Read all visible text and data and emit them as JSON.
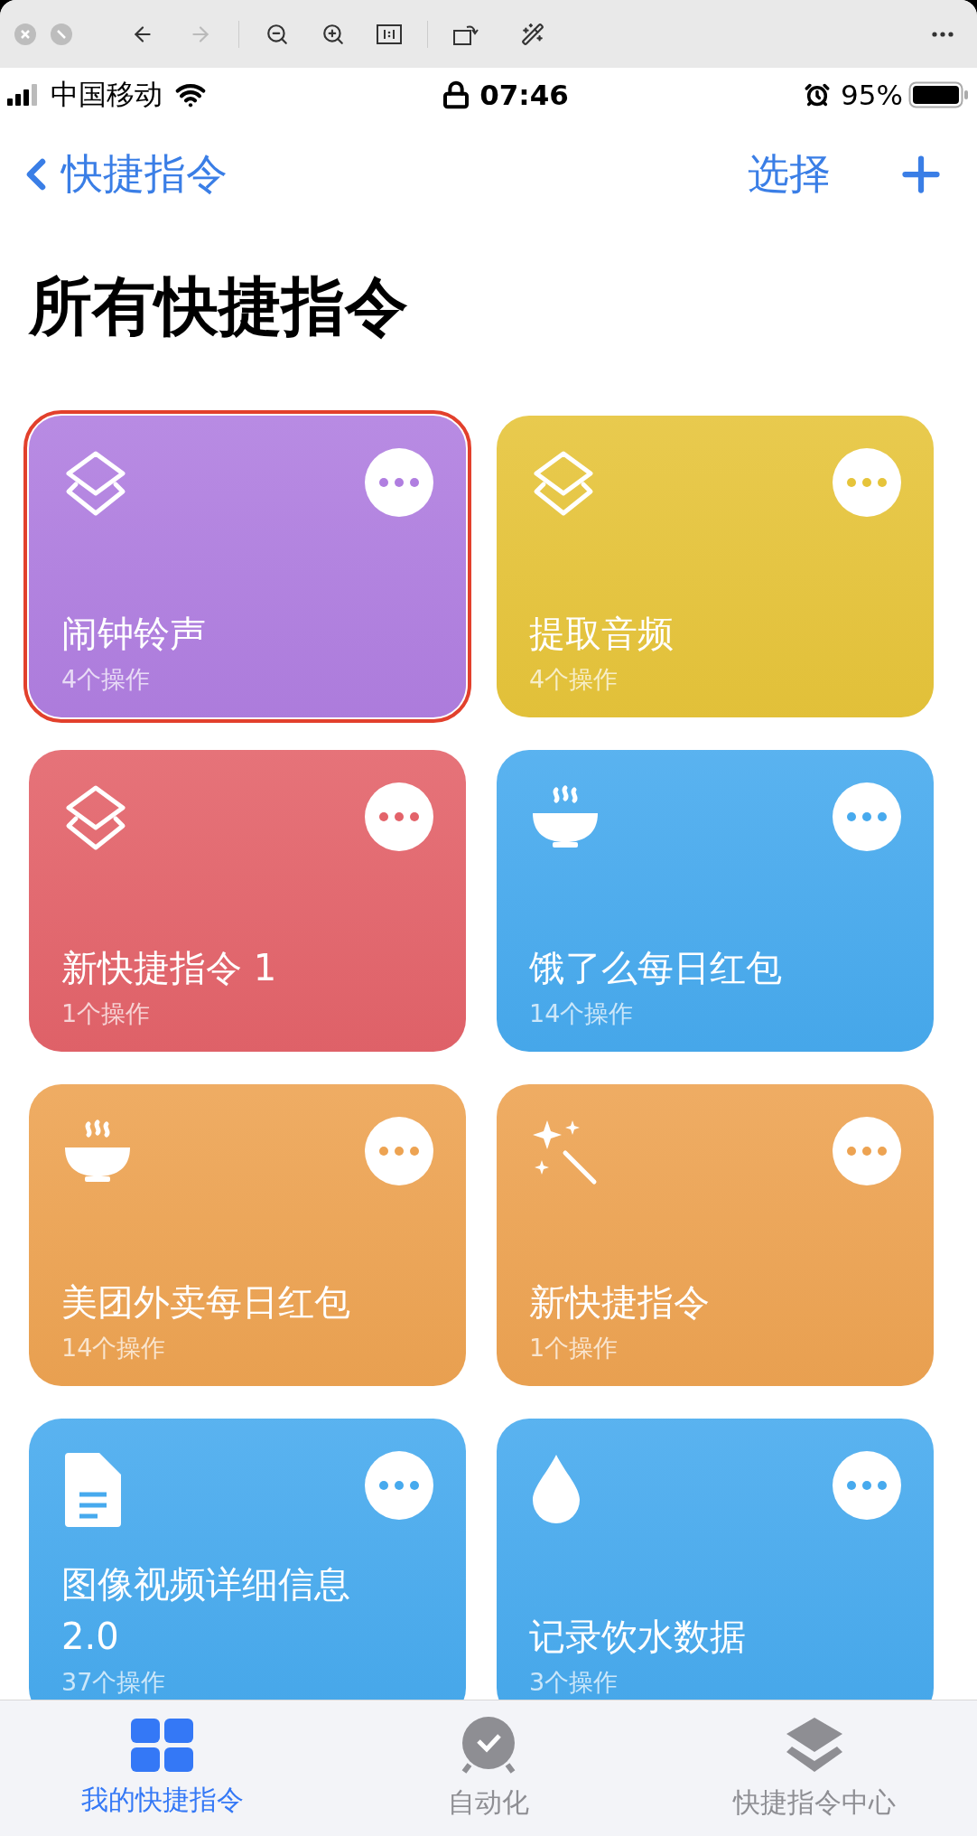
{
  "viewer_toolbar": {
    "back_disabled": false,
    "forward_disabled": true
  },
  "status_bar": {
    "carrier": "中国移动",
    "time": "07:46",
    "battery": "95%"
  },
  "nav": {
    "back": "快捷指令",
    "select": "选择"
  },
  "title": "所有快捷指令",
  "shortcuts": [
    {
      "title": "闹钟铃声",
      "subtitle": "4个操作",
      "color": "#b07ee0",
      "kind": "layers",
      "highlighted": true
    },
    {
      "title": "提取音频",
      "subtitle": "4个操作",
      "color": "#e6c43a",
      "kind": "layers",
      "highlighted": false
    },
    {
      "title": "新快捷指令 1",
      "subtitle": "1个操作",
      "color": "#e3636a",
      "kind": "layers",
      "highlighted": false
    },
    {
      "title": "饿了么每日红包",
      "subtitle": "14个操作",
      "color": "#47aaee",
      "kind": "bowl",
      "highlighted": false
    },
    {
      "title": "美团外卖每日红包",
      "subtitle": "14个操作",
      "color": "#eda352",
      "kind": "bowl",
      "highlighted": false
    },
    {
      "title": "新快捷指令",
      "subtitle": "1个操作",
      "color": "#eda352",
      "kind": "sparkles",
      "highlighted": false
    },
    {
      "title": "图像视频详细信息 2.0",
      "subtitle": "37个操作",
      "color": "#47aaee",
      "kind": "document",
      "highlighted": false
    },
    {
      "title": "记录饮水数据",
      "subtitle": "3个操作",
      "color": "#47aaee",
      "kind": "drop",
      "highlighted": false
    }
  ],
  "tabs": [
    {
      "label": "我的快捷指令",
      "kind": "grid",
      "selected": true
    },
    {
      "label": "自动化",
      "kind": "clock",
      "selected": false
    },
    {
      "label": "快捷指令中心",
      "kind": "layers",
      "selected": false
    }
  ]
}
